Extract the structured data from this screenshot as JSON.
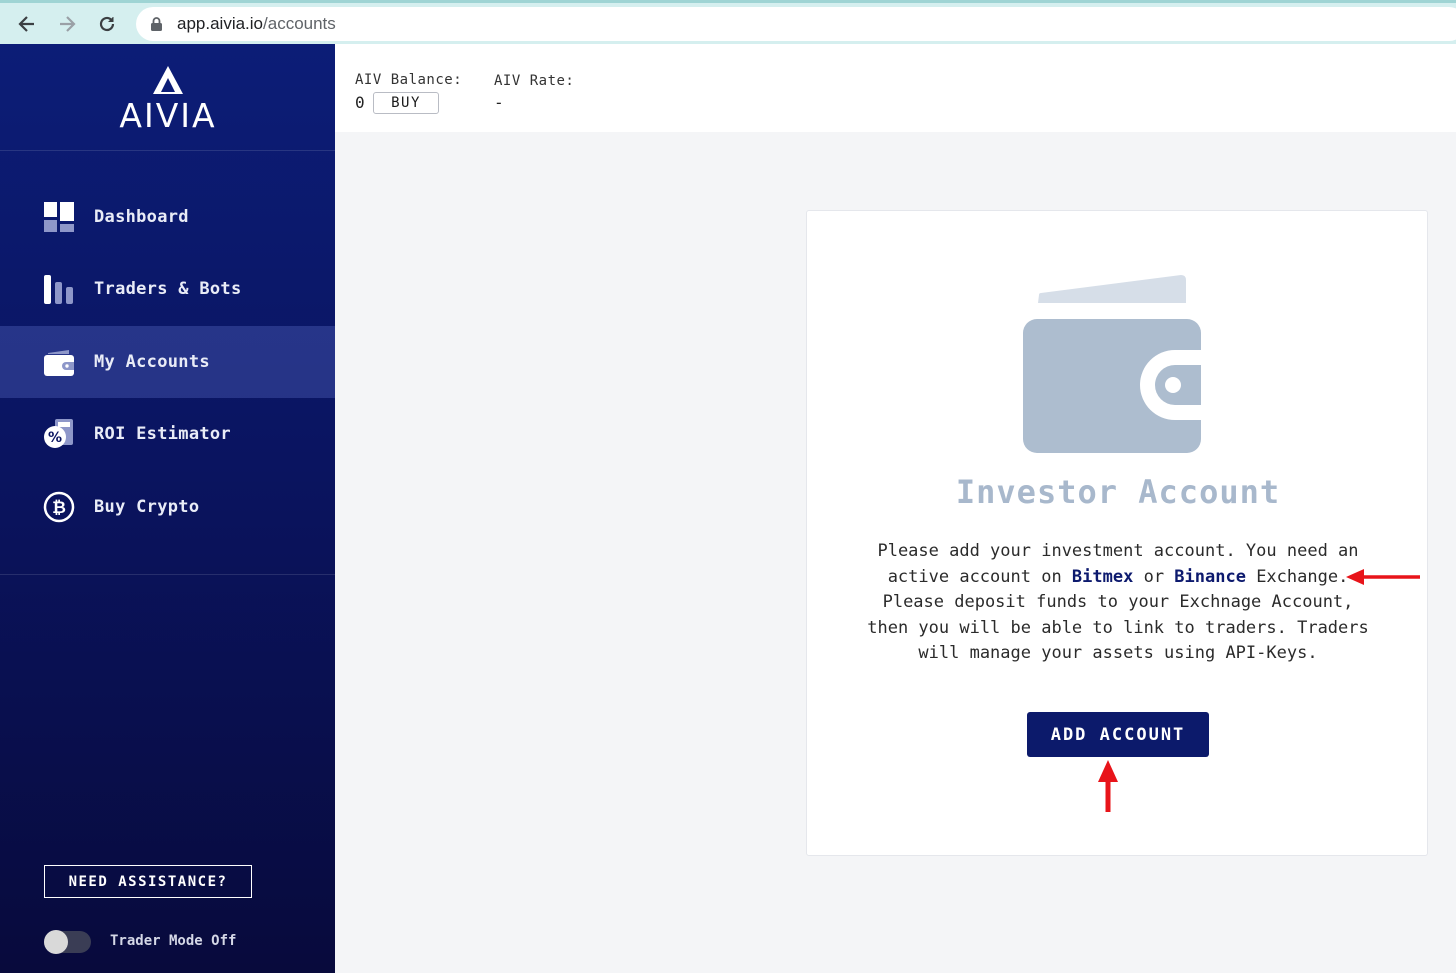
{
  "browser": {
    "url_host": "app.aivia.io",
    "url_path": "/accounts"
  },
  "sidebar": {
    "logo_text": "AIVIA",
    "items": [
      {
        "label": "Dashboard",
        "icon": "dashboard-icon",
        "active": false
      },
      {
        "label": "Traders & Bots",
        "icon": "bar-chart-icon",
        "active": false
      },
      {
        "label": "My Accounts",
        "icon": "wallet-icon",
        "active": true
      },
      {
        "label": "ROI Estimator",
        "icon": "percent-calculator-icon",
        "active": false
      },
      {
        "label": "Buy Crypto",
        "icon": "bitcoin-icon",
        "active": false
      }
    ],
    "assist_label": "NEED ASSISTANCE?",
    "trader_mode_label": "Trader Mode Off",
    "trader_mode_on": false
  },
  "topbar": {
    "balance_label": "AIV Balance:",
    "balance_value": "0",
    "buy_label": "BUY",
    "rate_label": "AIV Rate:",
    "rate_value": "-"
  },
  "card": {
    "title": "Investor Account",
    "text_1": "Please add your investment account. You need an active account on ",
    "link_1": "Bitmex",
    "text_or": " or ",
    "link_2": "Binance",
    "text_2": " Exchange. Please deposit funds to your Exchnage Account, then you will be able to link to traders. Traders will manage your assets using API-Keys.",
    "add_button": "ADD ACCOUNT"
  },
  "colors": {
    "sidebar_top": "#0c1d77",
    "sidebar_bottom": "#080a3c",
    "accent": "#0c1a6b",
    "wallet_icon": "#adbdcf",
    "annotation_arrow": "#e8141a"
  }
}
